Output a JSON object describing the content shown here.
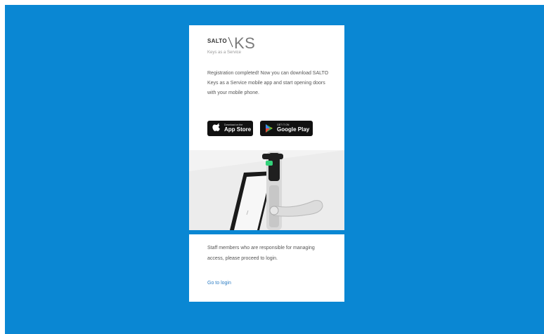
{
  "logo": {
    "brand": "SALTO",
    "product": "KS",
    "tagline": "Keys as a Service"
  },
  "registration": {
    "message": "Registration completed! Now you can download SALTO Keys as a Service mobile app and start opening doors with your mobile phone."
  },
  "stores": {
    "apple": {
      "small": "Download on the",
      "big": "App Store",
      "icon": "apple-icon"
    },
    "google": {
      "small": "GET IT ON",
      "big": "Google Play",
      "icon": "google-play-icon"
    }
  },
  "staff": {
    "message": "Staff members who are responsible for managing access, please proceed to login.",
    "link": "Go to login"
  },
  "colors": {
    "background": "#0a87d3",
    "card": "#ffffff",
    "link": "#2d7dc4",
    "lock_led": "#33d17a"
  }
}
